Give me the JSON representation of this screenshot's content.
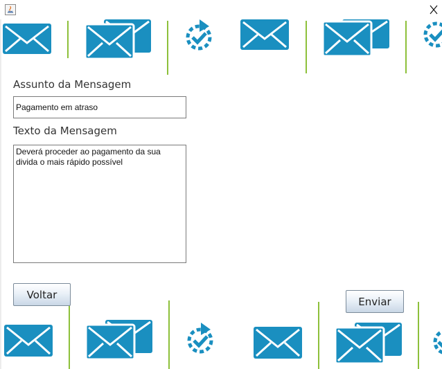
{
  "window": {
    "close_glyph": "✕"
  },
  "form": {
    "subject_label": "Assunto da Mensagem",
    "subject_value": "Pagamento em atraso",
    "body_label": "Texto da Mensagem",
    "body_value": "Deverá proceder ao pagamento da sua divida o mais rápido possível"
  },
  "buttons": {
    "back_label": "Voltar",
    "send_label": "Enviar"
  },
  "theme": {
    "icon_color": "#1a8fc0",
    "divider_color": "#8dc03a"
  },
  "decor": {
    "top_strip_icons": [
      "mail-icon",
      "mail-stack-icon",
      "refresh-check-icon",
      "mail-icon",
      "mail-stack-icon",
      "refresh-check-icon"
    ],
    "bottom_strip_icons": [
      "mail-icon",
      "mail-stack-icon",
      "refresh-check-icon",
      "mail-icon",
      "mail-stack-icon",
      "refresh-check-icon"
    ]
  }
}
